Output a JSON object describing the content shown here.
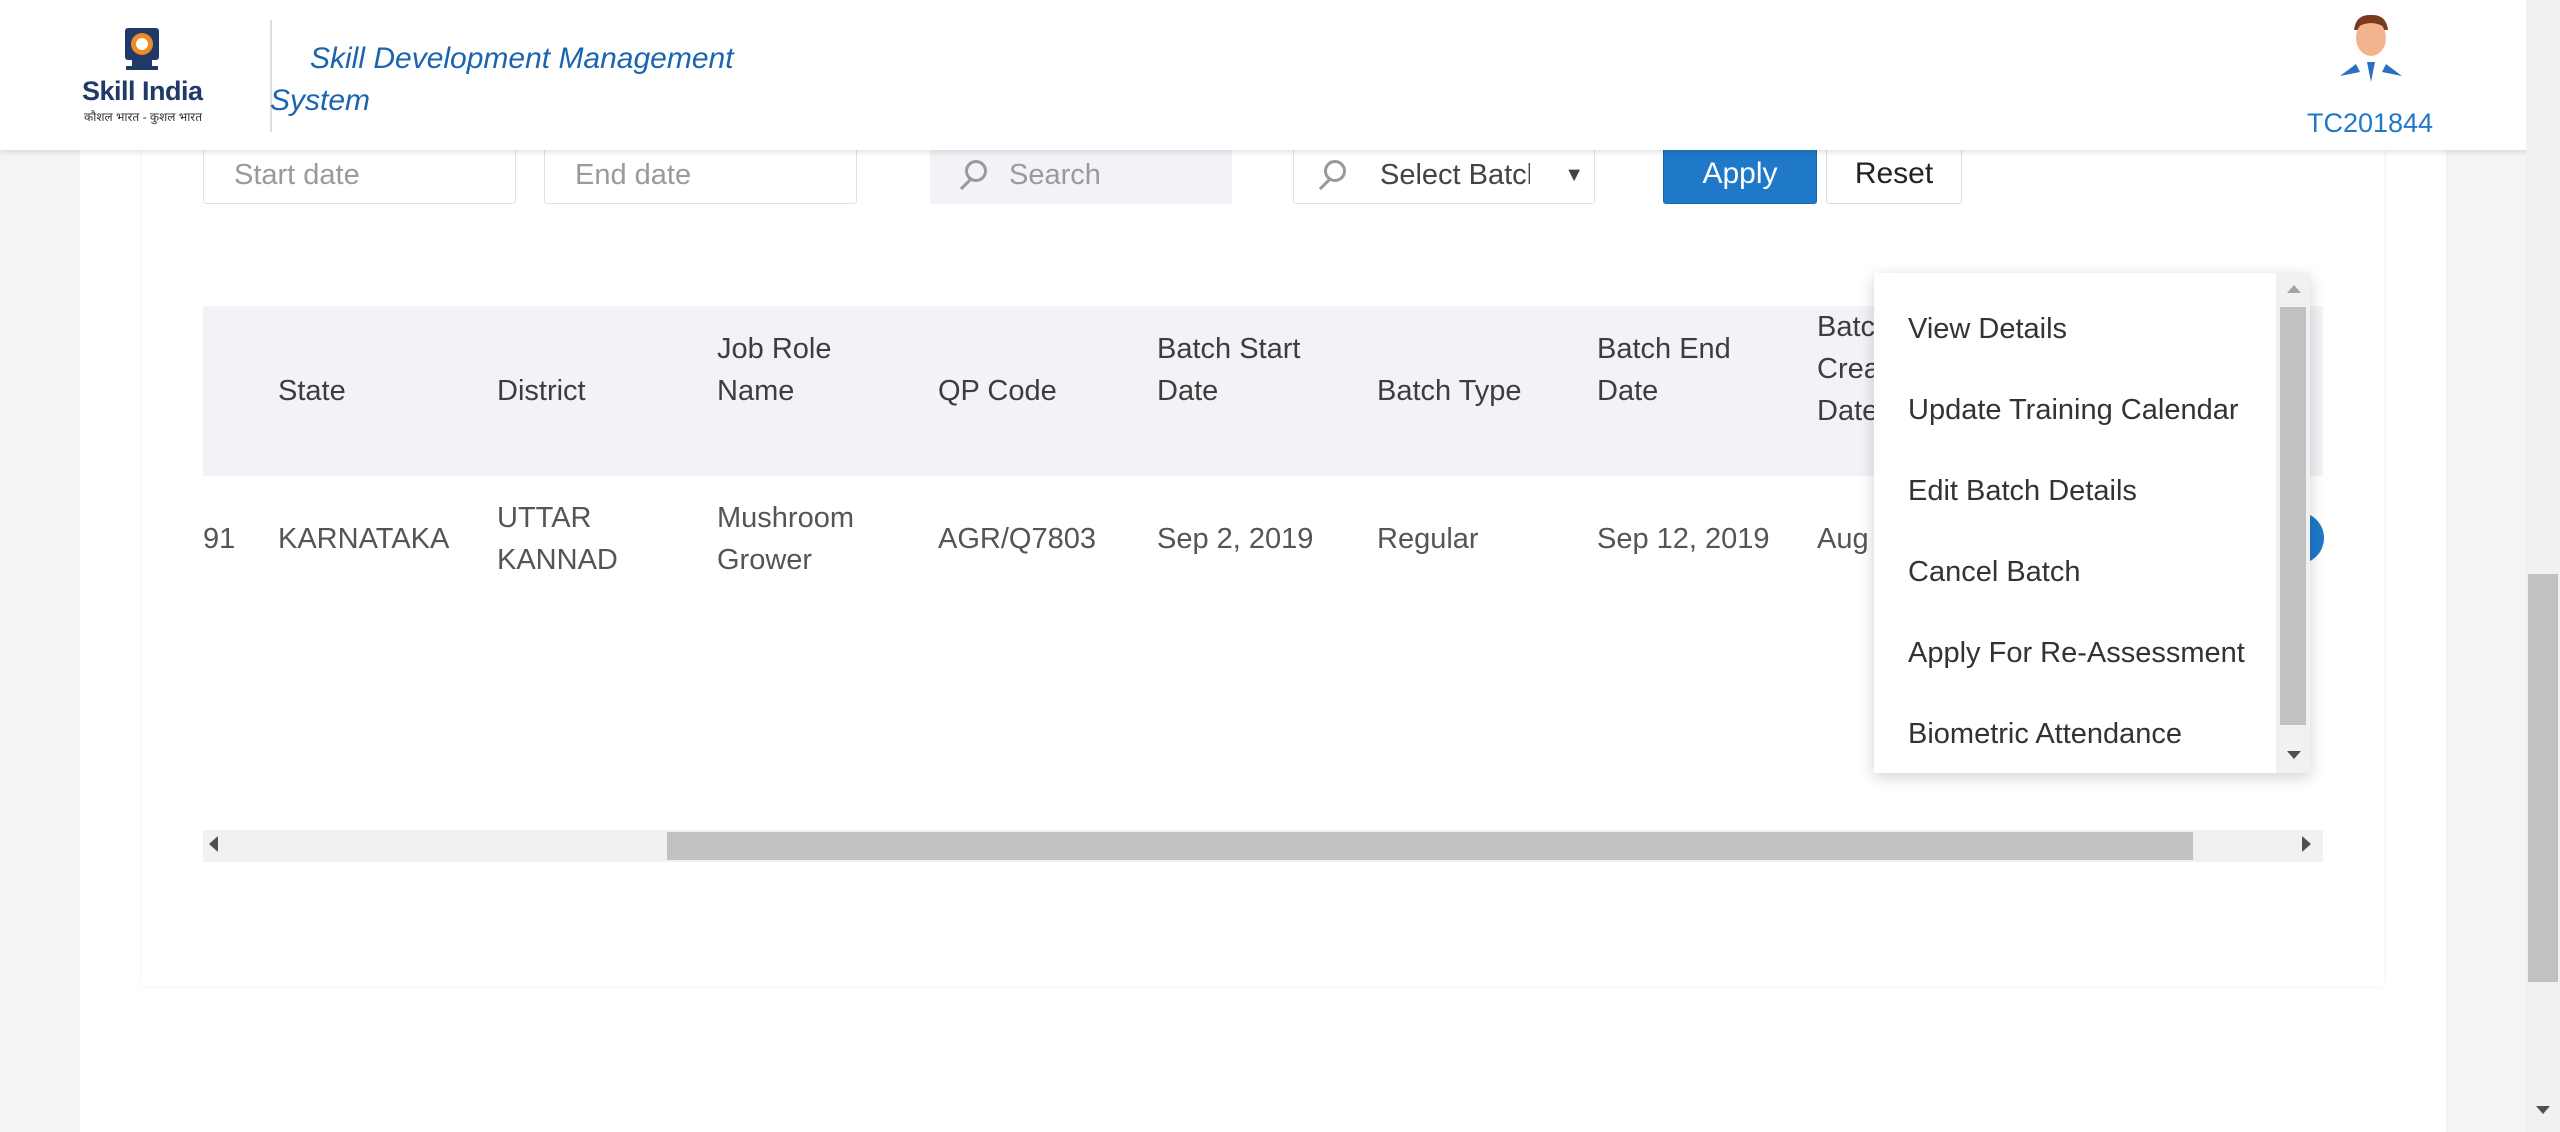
{
  "header": {
    "logo_text": "Skill India",
    "logo_tagline": "कौशल भारत - कुशल भारत",
    "system_title": "Skill Development Management System",
    "user_id": "TC201844"
  },
  "filters": {
    "start_date_placeholder": "Start date",
    "end_date_placeholder": "End date",
    "search_placeholder": "Search",
    "batch_select_value": "Select Batch",
    "apply_label": "Apply",
    "reset_label": "Reset"
  },
  "table": {
    "headers": {
      "state": "State",
      "district": "District",
      "job_role": "Job Role Name",
      "qp_code": "QP Code",
      "batch_start": "Batch Start Date",
      "batch_type": "Batch Type",
      "batch_end": "Batch End Date",
      "batch_created": "Batch Created Date"
    },
    "row": {
      "id_fragment": "91",
      "state": "KARNATAKA",
      "district": "UTTAR KANNAD",
      "job_role": "Mushroom Grower",
      "qp_code": "AGR/Q7803",
      "batch_start": "Sep 2, 2019",
      "batch_type": "Regular",
      "batch_end": "Sep 12, 2019",
      "batch_created": "Aug"
    }
  },
  "action_menu": {
    "items": [
      "View Details",
      "Update Training Calendar",
      "Edit Batch Details",
      "Cancel Batch",
      "Apply For Re-Assessment",
      "Biometric Attendance"
    ]
  },
  "colors": {
    "accent": "#1f78c8",
    "title_blue": "#1a64b0",
    "table_header_bg": "#f2f3f7"
  }
}
